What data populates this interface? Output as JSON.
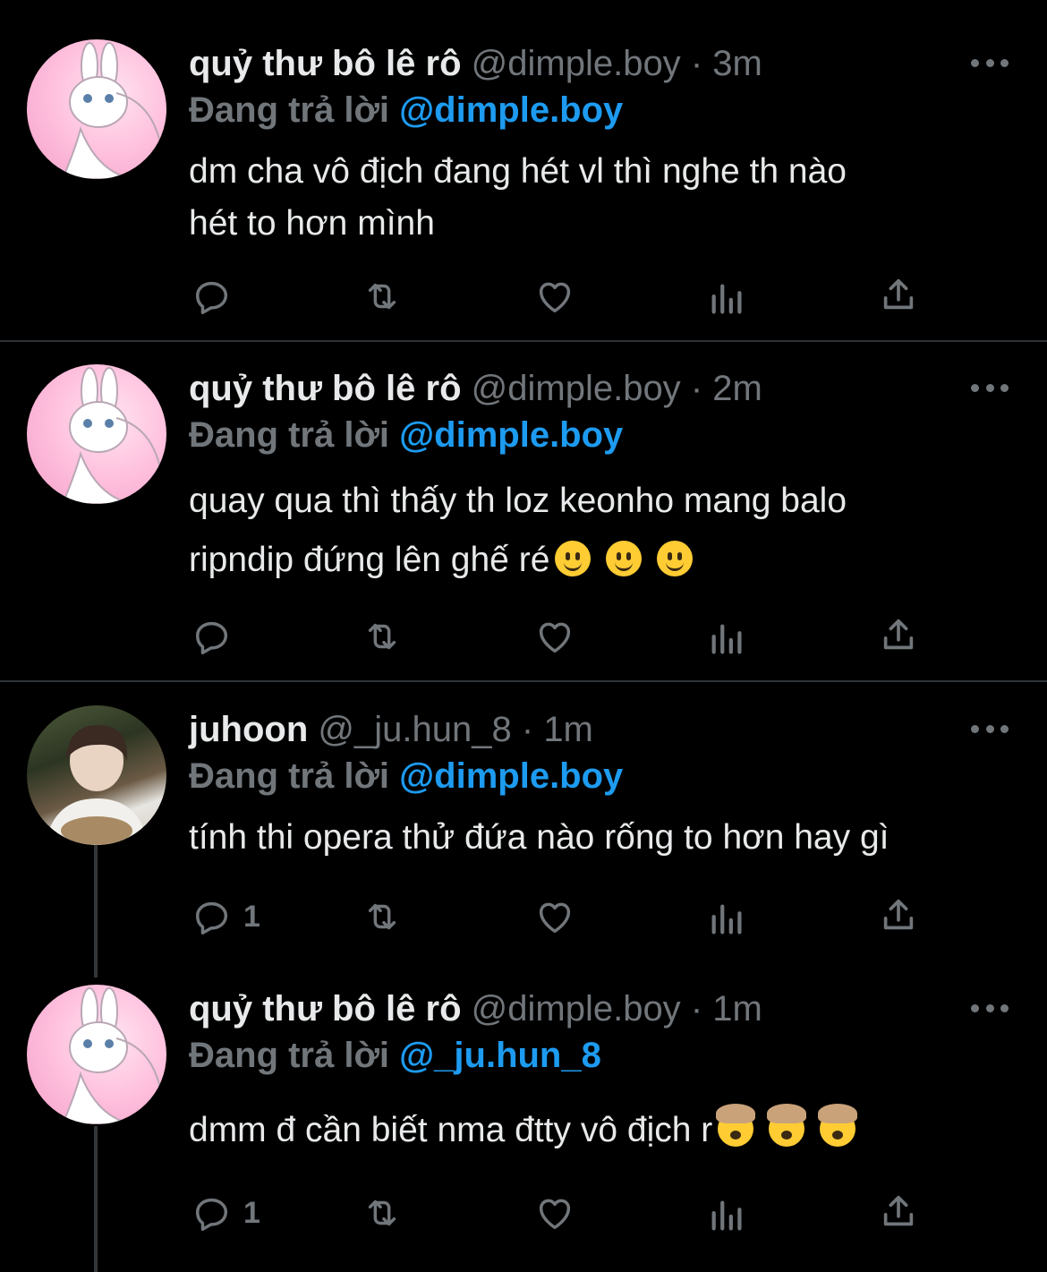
{
  "icons": {
    "reply": "comment-icon",
    "retweet": "retweet-icon",
    "like": "heart-icon",
    "analytics": "analytics-icon",
    "share": "share-icon",
    "more": "more-icon"
  },
  "colors": {
    "background": "#000000",
    "text": "#e7e9ea",
    "muted": "#71767b",
    "link": "#1d9bf0",
    "divider": "#2f3336"
  },
  "reply_prefix": "Đang trả lời",
  "tweets": [
    {
      "name": "quỷ thư bô lê rô",
      "handle": "@dimple.boy",
      "time": "3m",
      "reply_to": "@dimple.boy",
      "text_lines": [
        "dm cha vô địch đang hét vl thì nghe th nào",
        "hét to hơn mình"
      ],
      "reply_count": ""
    },
    {
      "name": "quỷ thư bô lê rô",
      "handle": "@dimple.boy",
      "time": "2m",
      "reply_to": "@dimple.boy",
      "text_lines": [
        "quay qua thì thấy th loz keonho mang balo",
        "ripndip đứng lên ghế ré"
      ],
      "reply_count": ""
    },
    {
      "name": "juhoon",
      "handle": "@_ju.hun_8",
      "time": "1m",
      "reply_to": "@dimple.boy",
      "text_lines": [
        "tính thi opera thử đứa nào rống to hơn hay gì"
      ],
      "reply_count": "1"
    },
    {
      "name": "quỷ thư bô lê rô",
      "handle": "@dimple.boy",
      "time": "1m",
      "reply_to": "@_ju.hun_8",
      "text_lines": [
        "dmm đ cần biết nma đtty vô địch r"
      ],
      "reply_count": "1"
    }
  ]
}
